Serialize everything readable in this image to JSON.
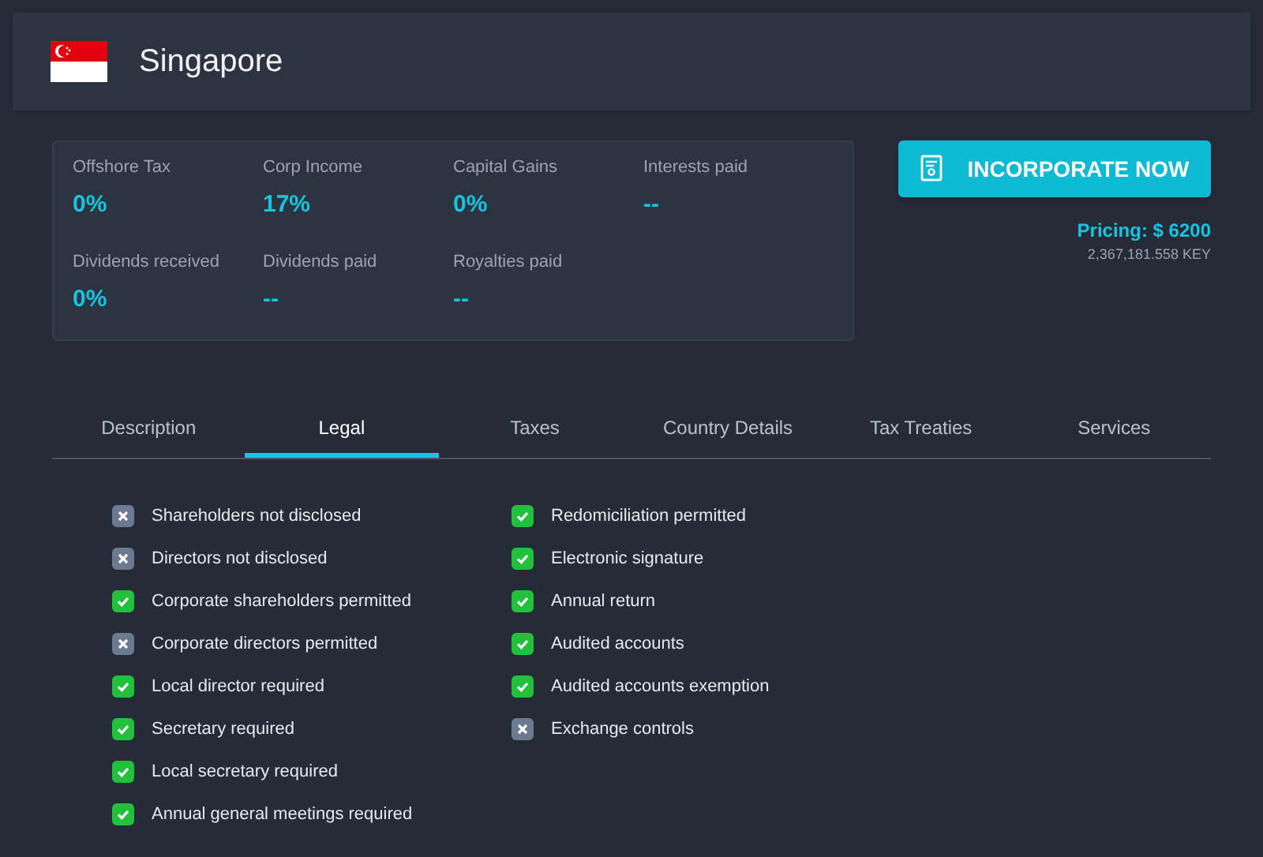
{
  "header": {
    "title": "Singapore"
  },
  "stats": [
    {
      "label": "Offshore Tax",
      "value": "0%"
    },
    {
      "label": "Corp Income",
      "value": "17%"
    },
    {
      "label": "Capital Gains",
      "value": "0%"
    },
    {
      "label": "Interests paid",
      "value": "--"
    },
    {
      "label": "Dividends received",
      "value": "0%"
    },
    {
      "label": "Dividends paid",
      "value": "--"
    },
    {
      "label": "Royalties paid",
      "value": "--"
    }
  ],
  "cta": {
    "label": "INCORPORATE NOW",
    "pricing": "Pricing: $ 6200",
    "key_price": "2,367,181.558 KEY"
  },
  "tabs": [
    {
      "label": "Description",
      "selected": false
    },
    {
      "label": "Legal",
      "selected": true
    },
    {
      "label": "Taxes",
      "selected": false
    },
    {
      "label": "Country Details",
      "selected": false
    },
    {
      "label": "Tax Treaties",
      "selected": false
    },
    {
      "label": "Services",
      "selected": false
    }
  ],
  "legal_columns": [
    [
      {
        "label": "Shareholders not disclosed",
        "permitted": false
      },
      {
        "label": "Directors not disclosed",
        "permitted": false
      },
      {
        "label": "Corporate shareholders permitted",
        "permitted": true
      },
      {
        "label": "Corporate directors permitted",
        "permitted": false
      },
      {
        "label": "Local director required",
        "permitted": true
      },
      {
        "label": "Secretary required",
        "permitted": true
      },
      {
        "label": "Local secretary required",
        "permitted": true
      },
      {
        "label": "Annual general meetings required",
        "permitted": true
      }
    ],
    [
      {
        "label": "Redomiciliation permitted",
        "permitted": true
      },
      {
        "label": "Electronic signature",
        "permitted": true
      },
      {
        "label": "Annual return",
        "permitted": true
      },
      {
        "label": "Audited accounts",
        "permitted": true
      },
      {
        "label": "Audited accounts exemption",
        "permitted": true
      },
      {
        "label": "Exchange controls",
        "permitted": false
      }
    ]
  ]
}
